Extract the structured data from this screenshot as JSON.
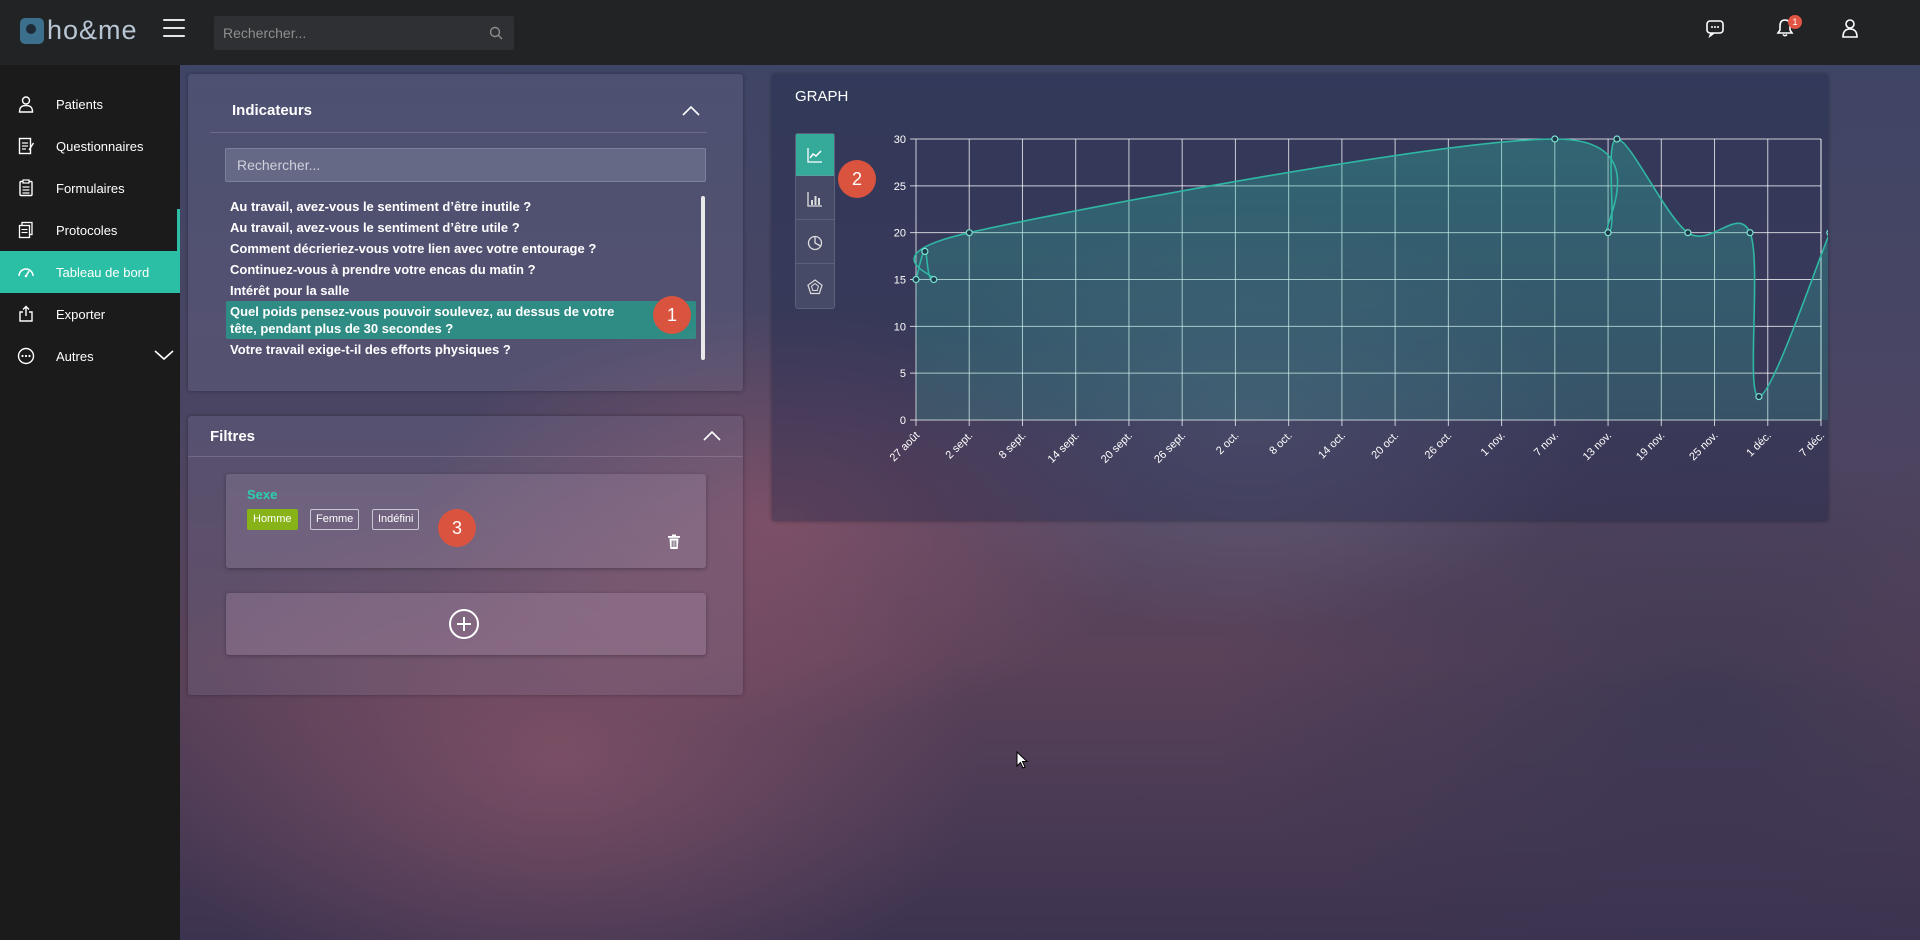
{
  "app": {
    "logo_text": "ho&me",
    "search_placeholder": "Rechercher...",
    "notification_count": "1"
  },
  "sidebar": {
    "items": [
      {
        "label": "Patients",
        "icon": "user-icon"
      },
      {
        "label": "Questionnaires",
        "icon": "document-icon"
      },
      {
        "label": "Formulaires",
        "icon": "clipboard-icon"
      },
      {
        "label": "Protocoles",
        "icon": "files-icon"
      },
      {
        "label": "Tableau de bord",
        "icon": "dashboard-icon",
        "active": true
      },
      {
        "label": "Exporter",
        "icon": "export-icon"
      },
      {
        "label": "Autres",
        "icon": "more-icon"
      }
    ]
  },
  "indicateurs": {
    "title": "Indicateurs",
    "search_placeholder": "Rechercher...",
    "items": [
      "Au travail, avez-vous le sentiment d’être inutile ?",
      "Au travail, avez-vous le sentiment d’être utile ?",
      "Comment décrieriez-vous votre lien avec votre entourage ?",
      "Continuez-vous à prendre votre encas du matin ?",
      "Intérêt pour la salle",
      "Quel poids pensez-vous pouvoir soulevez, au dessus de votre tête, pendant plus de 30 secondes ?",
      "Votre travail exige-t-il des efforts physiques ?"
    ],
    "selected_index": 5
  },
  "filtres": {
    "title": "Filtres",
    "card_title": "Sexe",
    "chips": [
      {
        "label": "Homme",
        "active": true
      },
      {
        "label": "Femme",
        "active": false
      },
      {
        "label": "Indéfini",
        "active": false
      }
    ]
  },
  "steps": [
    "1",
    "2",
    "3"
  ],
  "graph": {
    "title": "GRAPH",
    "tools": [
      "line-chart-icon",
      "bar-chart-icon",
      "pie-chart-icon",
      "radar-chart-icon"
    ],
    "active_tool": 0
  },
  "colors": {
    "accent": "#2bbfa5",
    "line": "#2fb7a3",
    "step": "#d9533e",
    "chip_active": "#87b319",
    "badge": "#e25545"
  },
  "chart_data": {
    "type": "line",
    "x_tick_labels": [
      "27 août",
      "2 sept.",
      "8 sept.",
      "14 sept.",
      "20 sept.",
      "26 sept.",
      "2 oct.",
      "8 oct.",
      "14 oct.",
      "20 oct.",
      "26 oct.",
      "1 nov.",
      "7 nov.",
      "13 nov.",
      "19 nov.",
      "25 nov.",
      "1 déc.",
      "7 déc."
    ],
    "x": [
      "2020-08-27",
      "2020-08-28",
      "2020-08-29",
      "2020-09-02",
      "2020-11-07",
      "2020-11-13",
      "2020-11-14",
      "2020-11-22",
      "2020-11-29",
      "2020-11-30",
      "2020-12-08"
    ],
    "values": [
      15,
      18,
      15,
      20,
      30,
      20,
      30,
      20,
      20,
      2.5,
      20
    ],
    "ylim": [
      0,
      30
    ],
    "y_ticks": [
      0,
      5,
      10,
      15,
      20,
      25,
      30
    ],
    "grid": true,
    "area_fill": true
  }
}
